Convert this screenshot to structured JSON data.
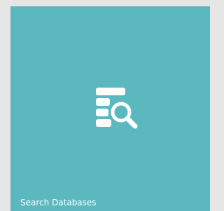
{
  "tile": {
    "label": "Search Databases",
    "icon": "database-search-icon",
    "background_color": "#5bb8bf",
    "text_color": "#ffffff"
  }
}
